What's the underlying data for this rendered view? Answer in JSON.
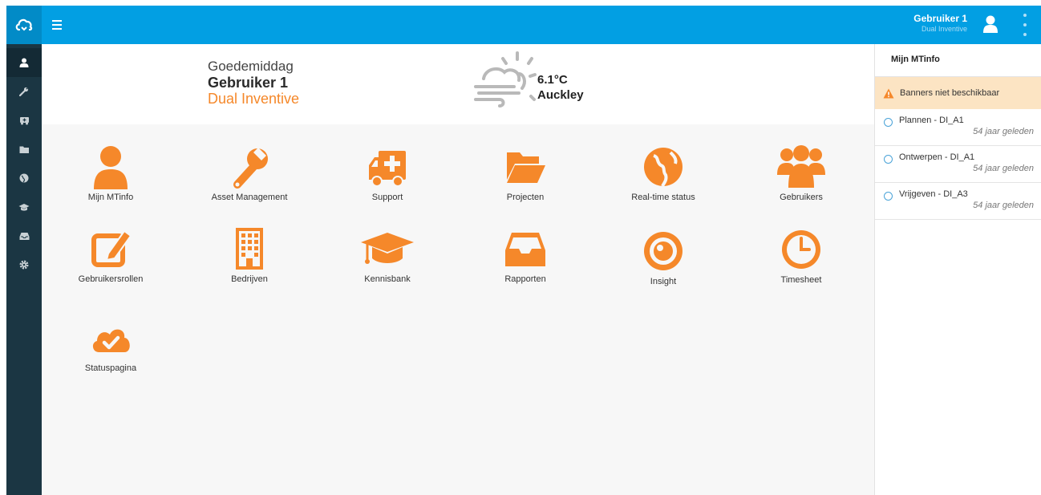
{
  "header": {
    "user_name": "Gebruiker 1",
    "user_company": "Dual Inventive"
  },
  "greeting": {
    "hello": "Goedemiddag",
    "name": "Gebruiker 1",
    "company": "Dual Inventive"
  },
  "weather": {
    "temperature": "6.1°C",
    "city": "Auckley",
    "icon": "cloud-wind-sun-icon"
  },
  "sidebar": {
    "items": [
      {
        "icon": "user-icon"
      },
      {
        "icon": "wrench-icon"
      },
      {
        "icon": "ambulance-icon"
      },
      {
        "icon": "folder-icon"
      },
      {
        "icon": "globe-icon"
      },
      {
        "icon": "graduation-cap-icon"
      },
      {
        "icon": "inbox-icon"
      },
      {
        "icon": "gear-icon"
      }
    ]
  },
  "tiles": [
    {
      "label": "Mijn MTinfo",
      "icon": "user-icon"
    },
    {
      "label": "Asset Management",
      "icon": "wrench-icon"
    },
    {
      "label": "Support",
      "icon": "ambulance-icon"
    },
    {
      "label": "Projecten",
      "icon": "folder-open-icon"
    },
    {
      "label": "Real-time status",
      "icon": "globe-icon"
    },
    {
      "label": "Gebruikers",
      "icon": "users-icon"
    },
    {
      "label": "Gebruikersrollen",
      "icon": "edit-icon"
    },
    {
      "label": "Bedrijven",
      "icon": "building-icon"
    },
    {
      "label": "Kennisbank",
      "icon": "graduation-cap-icon"
    },
    {
      "label": "Rapporten",
      "icon": "inbox-icon"
    },
    {
      "label": "Insight",
      "icon": "eye-icon"
    },
    {
      "label": "Timesheet",
      "icon": "clock-icon"
    },
    {
      "label": "Statuspagina",
      "icon": "cloud-check-icon"
    }
  ],
  "right_panel": {
    "title": "Mijn MTinfo",
    "banner": "Banners niet beschikbaar",
    "items": [
      {
        "name": "Plannen - DI_A1",
        "time": "54 jaar geleden"
      },
      {
        "name": "Ontwerpen - DI_A1",
        "time": "54 jaar geleden"
      },
      {
        "name": "Vrijgeven - DI_A3",
        "time": "54 jaar geleden"
      }
    ]
  },
  "colors": {
    "topbar": "#029fe3",
    "sidebar": "#1b3643",
    "accent": "#f5882a",
    "banner_bg": "#fce4c3"
  }
}
